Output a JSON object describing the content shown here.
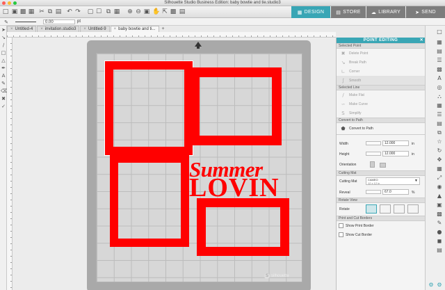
{
  "window": {
    "title": "Silhouette Studio Business Edition: baby bowtie and tie.studio3",
    "traffic_lights": {
      "close": "#fe5f57",
      "minimize": "#febc2e",
      "zoom": "#28c840"
    }
  },
  "nav": {
    "design": "DESIGN",
    "store": "STORE",
    "library": "LIBRARY",
    "send": "SEND",
    "accent": "#39a6b5"
  },
  "options": {
    "line_width": "0.00",
    "unit": "pt"
  },
  "doc_tabs": [
    {
      "label": "Untitled-4"
    },
    {
      "label": "invitation.studio3"
    },
    {
      "label": "Untitled-9"
    },
    {
      "label": "baby bowtie and ti..."
    }
  ],
  "mat": {
    "brand": "silhouette"
  },
  "design": {
    "word1": "Summer",
    "word2": "LOVIN",
    "color": "#ff0000"
  },
  "panel": {
    "title": "POINT EDITING",
    "selected_point": {
      "header": "Selected Point",
      "items": [
        "Delete Point",
        "Break Path",
        "Corner",
        "Smooth"
      ]
    },
    "selected_line": {
      "header": "Selected Line",
      "items": [
        "Make Flat",
        "Make Curve",
        "Simplify"
      ]
    },
    "convert": {
      "header": "Convert to Path",
      "button": "Convert to Path"
    },
    "width": {
      "label": "Width",
      "value": "12.000",
      "unit": "in"
    },
    "height": {
      "label": "Height",
      "value": "12.000",
      "unit": "in"
    },
    "orientation": {
      "label": "Orientation"
    },
    "cutting_mat_section": "Cutting Mat",
    "cutting_mat": {
      "label": "Cutting Mat",
      "line1": "CAMEO",
      "line2": "12 x 12 in"
    },
    "reveal": {
      "label": "Reveal",
      "value": "67.0",
      "unit": "%"
    },
    "rotate_view_section": "Rotate View",
    "rotate": {
      "label": "Rotate"
    },
    "print_cut_section": "Print and Cut Borders",
    "show_print_border": "Show Print Border",
    "show_cut_border": "Show Cut Border"
  }
}
